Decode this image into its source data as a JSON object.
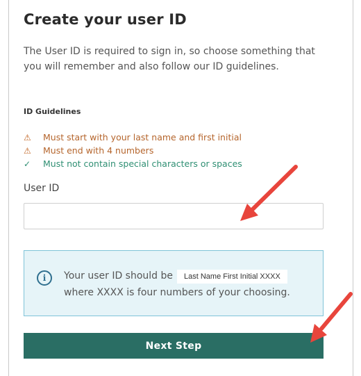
{
  "page": {
    "title": "Create your user ID",
    "description": "The User ID is required to sign in, so choose something that you will remember and also follow our ID guidelines."
  },
  "guidelines": {
    "heading": "ID Guidelines",
    "items": [
      {
        "icon": "warning-icon",
        "status": "warning",
        "text": "Must start with your last name and first initial"
      },
      {
        "icon": "warning-icon",
        "status": "warning",
        "text": "Must end with 4 numbers"
      },
      {
        "icon": "check-icon",
        "status": "ok",
        "text": "Must not contain special characters or spaces"
      }
    ]
  },
  "user_id_field": {
    "label": "User ID",
    "value": "",
    "placeholder": ""
  },
  "info_box": {
    "prefix": "Your user ID should be",
    "format": "Last Name First Initial XXXX",
    "suffix": "where XXXX is four numbers of your choosing."
  },
  "next_button": {
    "label": "Next Step"
  },
  "colors": {
    "warning": "#b5652c",
    "ok": "#2f8f73",
    "button": "#2a6e64",
    "info_bg": "#e6f4f8",
    "info_border": "#7fc3d8",
    "annotation_arrow": "#e8453c"
  }
}
